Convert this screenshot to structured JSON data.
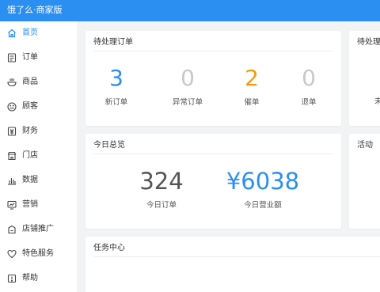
{
  "app": {
    "title": "饿了么·商家版"
  },
  "colors": {
    "brand": "#2a8ff0",
    "orange": "#f59a0f",
    "grey": "#c8c8c8",
    "dark": "#555555"
  },
  "sidebar": {
    "items": [
      {
        "label": "首页",
        "icon": "home-icon",
        "active": true
      },
      {
        "label": "订单",
        "icon": "order-icon"
      },
      {
        "label": "商品",
        "icon": "bowl-icon"
      },
      {
        "label": "顾客",
        "icon": "smile-icon"
      },
      {
        "label": "财务",
        "icon": "finance-icon"
      },
      {
        "label": "门店",
        "icon": "store-icon"
      },
      {
        "label": "数据",
        "icon": "bar-chart-icon"
      },
      {
        "label": "营销",
        "icon": "marketing-icon"
      },
      {
        "label": "店铺推广",
        "icon": "promotion-icon"
      },
      {
        "label": "特色服务",
        "icon": "heart-icon"
      },
      {
        "label": "帮助",
        "icon": "help-icon"
      }
    ]
  },
  "pending_orders": {
    "title": "待处理订单",
    "stats": [
      {
        "value": "3",
        "label": "新订单"
      },
      {
        "value": "0",
        "label": "异常订单"
      },
      {
        "value": "2",
        "label": "催单"
      },
      {
        "value": "0",
        "label": "退单"
      }
    ]
  },
  "pending_right": {
    "title": "待处理",
    "partial_label": "未"
  },
  "today": {
    "title": "今日总览",
    "orders": {
      "value": "324",
      "label": "今日订单"
    },
    "revenue": {
      "value": "¥6038",
      "label": "今日营业额"
    }
  },
  "activity": {
    "title": "活动"
  },
  "tasks": {
    "title": "任务中心"
  }
}
